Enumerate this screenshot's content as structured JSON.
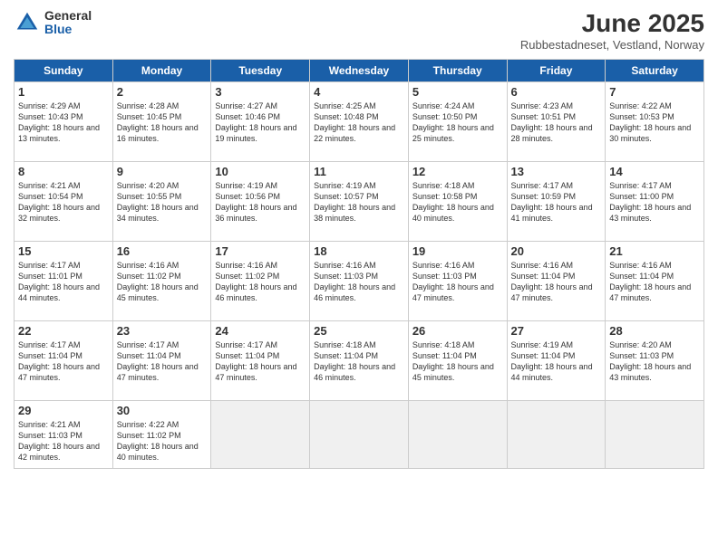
{
  "header": {
    "logo_general": "General",
    "logo_blue": "Blue",
    "month_title": "June 2025",
    "location": "Rubbestadneset, Vestland, Norway"
  },
  "days_of_week": [
    "Sunday",
    "Monday",
    "Tuesday",
    "Wednesday",
    "Thursday",
    "Friday",
    "Saturday"
  ],
  "weeks": [
    [
      {
        "day": "1",
        "sunrise": "4:29 AM",
        "sunset": "10:43 PM",
        "daylight": "18 hours and 13 minutes."
      },
      {
        "day": "2",
        "sunrise": "4:28 AM",
        "sunset": "10:45 PM",
        "daylight": "18 hours and 16 minutes."
      },
      {
        "day": "3",
        "sunrise": "4:27 AM",
        "sunset": "10:46 PM",
        "daylight": "18 hours and 19 minutes."
      },
      {
        "day": "4",
        "sunrise": "4:25 AM",
        "sunset": "10:48 PM",
        "daylight": "18 hours and 22 minutes."
      },
      {
        "day": "5",
        "sunrise": "4:24 AM",
        "sunset": "10:50 PM",
        "daylight": "18 hours and 25 minutes."
      },
      {
        "day": "6",
        "sunrise": "4:23 AM",
        "sunset": "10:51 PM",
        "daylight": "18 hours and 28 minutes."
      },
      {
        "day": "7",
        "sunrise": "4:22 AM",
        "sunset": "10:53 PM",
        "daylight": "18 hours and 30 minutes."
      }
    ],
    [
      {
        "day": "8",
        "sunrise": "4:21 AM",
        "sunset": "10:54 PM",
        "daylight": "18 hours and 32 minutes."
      },
      {
        "day": "9",
        "sunrise": "4:20 AM",
        "sunset": "10:55 PM",
        "daylight": "18 hours and 34 minutes."
      },
      {
        "day": "10",
        "sunrise": "4:19 AM",
        "sunset": "10:56 PM",
        "daylight": "18 hours and 36 minutes."
      },
      {
        "day": "11",
        "sunrise": "4:19 AM",
        "sunset": "10:57 PM",
        "daylight": "18 hours and 38 minutes."
      },
      {
        "day": "12",
        "sunrise": "4:18 AM",
        "sunset": "10:58 PM",
        "daylight": "18 hours and 40 minutes."
      },
      {
        "day": "13",
        "sunrise": "4:17 AM",
        "sunset": "10:59 PM",
        "daylight": "18 hours and 41 minutes."
      },
      {
        "day": "14",
        "sunrise": "4:17 AM",
        "sunset": "11:00 PM",
        "daylight": "18 hours and 43 minutes."
      }
    ],
    [
      {
        "day": "15",
        "sunrise": "4:17 AM",
        "sunset": "11:01 PM",
        "daylight": "18 hours and 44 minutes."
      },
      {
        "day": "16",
        "sunrise": "4:16 AM",
        "sunset": "11:02 PM",
        "daylight": "18 hours and 45 minutes."
      },
      {
        "day": "17",
        "sunrise": "4:16 AM",
        "sunset": "11:02 PM",
        "daylight": "18 hours and 46 minutes."
      },
      {
        "day": "18",
        "sunrise": "4:16 AM",
        "sunset": "11:03 PM",
        "daylight": "18 hours and 46 minutes."
      },
      {
        "day": "19",
        "sunrise": "4:16 AM",
        "sunset": "11:03 PM",
        "daylight": "18 hours and 47 minutes."
      },
      {
        "day": "20",
        "sunrise": "4:16 AM",
        "sunset": "11:04 PM",
        "daylight": "18 hours and 47 minutes."
      },
      {
        "day": "21",
        "sunrise": "4:16 AM",
        "sunset": "11:04 PM",
        "daylight": "18 hours and 47 minutes."
      }
    ],
    [
      {
        "day": "22",
        "sunrise": "4:17 AM",
        "sunset": "11:04 PM",
        "daylight": "18 hours and 47 minutes."
      },
      {
        "day": "23",
        "sunrise": "4:17 AM",
        "sunset": "11:04 PM",
        "daylight": "18 hours and 47 minutes."
      },
      {
        "day": "24",
        "sunrise": "4:17 AM",
        "sunset": "11:04 PM",
        "daylight": "18 hours and 47 minutes."
      },
      {
        "day": "25",
        "sunrise": "4:18 AM",
        "sunset": "11:04 PM",
        "daylight": "18 hours and 46 minutes."
      },
      {
        "day": "26",
        "sunrise": "4:18 AM",
        "sunset": "11:04 PM",
        "daylight": "18 hours and 45 minutes."
      },
      {
        "day": "27",
        "sunrise": "4:19 AM",
        "sunset": "11:04 PM",
        "daylight": "18 hours and 44 minutes."
      },
      {
        "day": "28",
        "sunrise": "4:20 AM",
        "sunset": "11:03 PM",
        "daylight": "18 hours and 43 minutes."
      }
    ],
    [
      {
        "day": "29",
        "sunrise": "4:21 AM",
        "sunset": "11:03 PM",
        "daylight": "18 hours and 42 minutes."
      },
      {
        "day": "30",
        "sunrise": "4:22 AM",
        "sunset": "11:02 PM",
        "daylight": "18 hours and 40 minutes."
      },
      null,
      null,
      null,
      null,
      null
    ]
  ]
}
